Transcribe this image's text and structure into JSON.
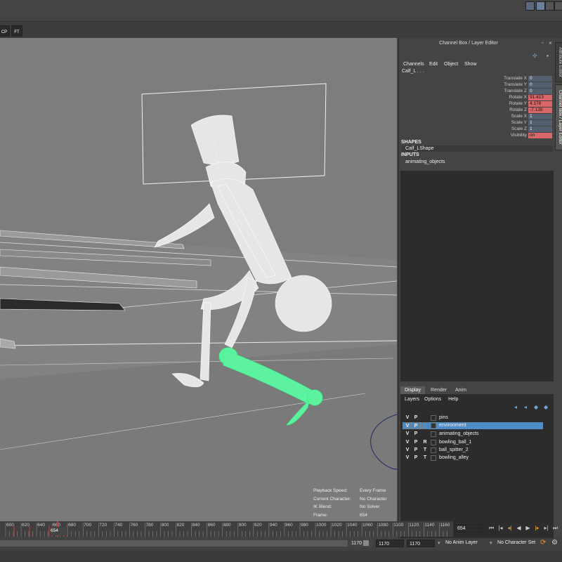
{
  "shelf": {
    "cp_label": "CP",
    "ft_label": "FT"
  },
  "channel_box": {
    "title": "Channel Box / Layer Editor",
    "menus": [
      "Channels",
      "Edit",
      "Object",
      "Show"
    ],
    "object_name": "Calf_L . . .",
    "attributes": [
      {
        "label": "Translate X",
        "value": "0",
        "keyed": false
      },
      {
        "label": "Translate Y",
        "value": "0",
        "keyed": false
      },
      {
        "label": "Translate Z",
        "value": "0",
        "keyed": false
      },
      {
        "label": "Rotate X",
        "value": "91.413",
        "keyed": true
      },
      {
        "label": "Rotate Y",
        "value": "4.178",
        "keyed": true
      },
      {
        "label": "Rotate Z",
        "value": "-7.139",
        "keyed": true
      },
      {
        "label": "Scale X",
        "value": "1",
        "keyed": false
      },
      {
        "label": "Scale Y",
        "value": "1",
        "keyed": false
      },
      {
        "label": "Scale Z",
        "value": "1",
        "keyed": false
      },
      {
        "label": "Visibility",
        "value": "on",
        "keyed": true
      }
    ],
    "shapes_header": "SHAPES",
    "shape_name": "Calf_LShape",
    "inputs_header": "INPUTS",
    "input_name": "animating_objects",
    "side_tabs": [
      "Attribute Editor",
      "Channel Box / Layer Editor"
    ]
  },
  "layer_editor": {
    "tabs": [
      "Display",
      "Render",
      "Anim"
    ],
    "menus": [
      "Layers",
      "Options",
      "Help"
    ],
    "layers": [
      {
        "v": "V",
        "p": "P",
        "t": "",
        "name": "pins",
        "selected": false
      },
      {
        "v": "V",
        "p": "P",
        "t": "",
        "name": "environment",
        "selected": true
      },
      {
        "v": "V",
        "p": "P",
        "t": "",
        "name": "animating_objects",
        "selected": false
      },
      {
        "v": "V",
        "p": "P",
        "t": "R",
        "name": "bowling_ball_1",
        "selected": false
      },
      {
        "v": "V",
        "p": "P",
        "t": "T",
        "name": "ball_spitter_2",
        "selected": false
      },
      {
        "v": "V",
        "p": "P",
        "t": "T",
        "name": "bowling_alley",
        "selected": false
      }
    ]
  },
  "hud": [
    {
      "key": "Playback Speed:",
      "value": "Every Frame"
    },
    {
      "key": "Current Character:",
      "value": "No Character"
    },
    {
      "key": "IK Blend:",
      "value": "No Solver"
    },
    {
      "key": "Frame:",
      "value": "654"
    }
  ],
  "timeline": {
    "ticks": [
      "600",
      "620",
      "640",
      "660",
      "680",
      "700",
      "720",
      "740",
      "760",
      "780",
      "800",
      "820",
      "840",
      "860",
      "880",
      "900",
      "920",
      "940",
      "960",
      "980",
      "1000",
      "1020",
      "1040",
      "1060",
      "1080",
      "1100",
      "1120",
      "1140",
      "1160"
    ],
    "current_frame": "654",
    "current_frame_field": "654"
  },
  "range": {
    "range_end": "1170",
    "anim_end": "1170",
    "playback_end": "1170",
    "anim_layer": "No Anim Layer",
    "character_set": "No Character Set"
  },
  "colors": {
    "accent": "#4f8bc4",
    "keyed": "#d9676a",
    "selection_wire": "#3df58a",
    "viewport": "#7d7d7d"
  }
}
